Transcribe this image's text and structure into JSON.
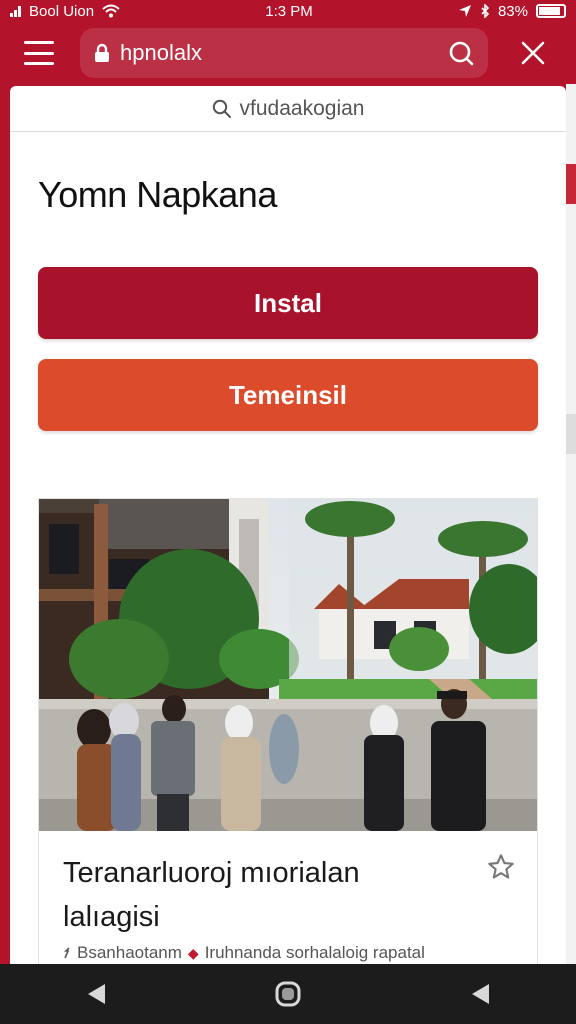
{
  "status_bar": {
    "carrier": "Bool Uion",
    "time": "1:3 PM",
    "battery": "83%"
  },
  "browser": {
    "url": "hpnolalx",
    "icons": [
      "menu-icon",
      "lock-icon",
      "search-icon",
      "close-icon"
    ]
  },
  "search": {
    "text": "vfudaakogian"
  },
  "page": {
    "title": "Yomn Napkana",
    "primary_button": "Instal",
    "secondary_button": "Temeinsil"
  },
  "article": {
    "title": "Teranarluoroj mıorialan lalıagisi",
    "meta_author": "Bsanhaotanm",
    "meta_text": "Iruhnanda sorhalaloig rapatal"
  },
  "colors": {
    "brand_red": "#b3142c",
    "install_button": "#a8122b",
    "secondary_button": "#dc4c2c",
    "nav_bar": "#1c1c1c"
  }
}
